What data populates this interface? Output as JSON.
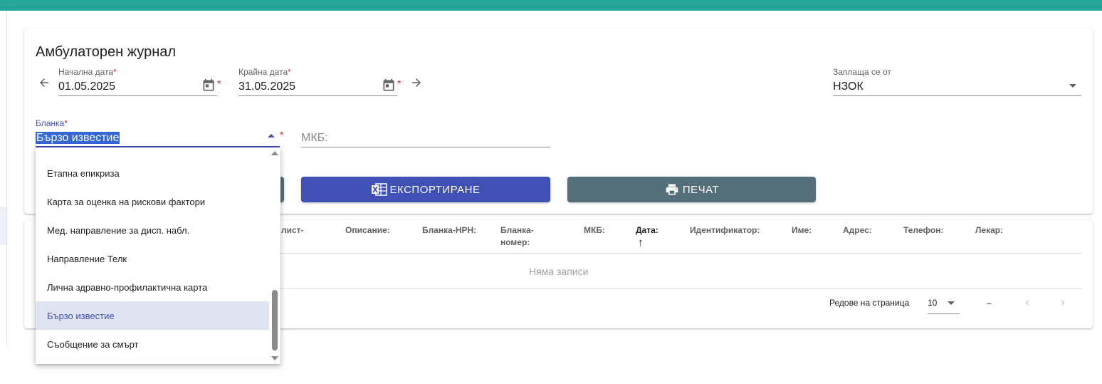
{
  "page": {
    "title": "Амбулаторен журнал"
  },
  "filters": {
    "start_date": {
      "label": "Начална дата",
      "required": "*",
      "value": "01.05.2025"
    },
    "end_date": {
      "label": "Крайна дата",
      "required": "*",
      "value": "31.05.2025"
    },
    "payer": {
      "label": "Заплаща се от",
      "value": "НЗОК"
    },
    "form": {
      "label": "Бланка",
      "required": "*",
      "value": "Бързо известие"
    },
    "mkb": {
      "placeholder": "МКБ:"
    }
  },
  "buttons": {
    "export_label": "ЕКСПОРТИРАНЕ",
    "print_label": "ПЕЧАТ"
  },
  "table": {
    "columns": [
      "лист-",
      "Описание:",
      "Бланка-НРН:",
      "Бланка-номер:",
      "МКБ:",
      "Дата:",
      "Идентификатор:",
      "Име:",
      "Адрес:",
      "Телефон:",
      "Лекар:"
    ],
    "col_blanka_nomer_line1": "Бланка-",
    "col_blanka_nomer_line2": "номер:",
    "sort_indicator": "↑",
    "empty_text": "Няма записи"
  },
  "pagination": {
    "rows_label": "Редове на страница",
    "rows_value": "10",
    "range": "–"
  },
  "dropdown": {
    "options": [
      "Етапна епикриза",
      "Карта за оценка на рискови фактори",
      "Мед. направление за дисп. набл.",
      "Направление Телк",
      "Лична здравно-профилактична карта",
      "Бързо известие",
      "Съобщение за смърт"
    ],
    "selected": "Бързо известие"
  },
  "colors": {
    "topbar": "#26a69a",
    "primary": "#3f51b5",
    "print_button": "#546e7a",
    "required": "#d32f2f"
  }
}
